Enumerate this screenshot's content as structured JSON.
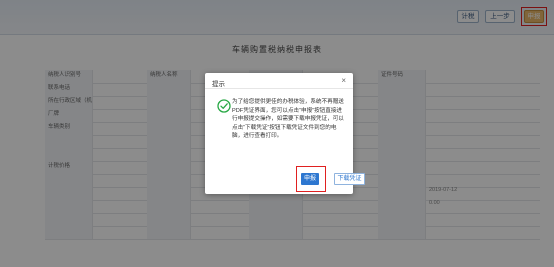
{
  "toolbar": {
    "calc_label": "计税",
    "prev_label": "上一步",
    "declare_label": "申报"
  },
  "page": {
    "title": "车辆购置税纳税申报表"
  },
  "form_rows": [
    {
      "label": "纳税人识别号",
      "value": "",
      "label2": "纳税人名称",
      "value2": "",
      "label3": "",
      "value3": "",
      "label4": "证件号码",
      "value4": ""
    },
    {
      "label": "联系电话",
      "value": "",
      "label2": "",
      "value2": "",
      "label3": "",
      "value3": "",
      "label4": "",
      "value4": ""
    },
    {
      "label": "所在行政区域（机动车登记地）",
      "value": "",
      "label2": "",
      "value2": "",
      "label3": "",
      "value3": "",
      "label4": "",
      "value4": ""
    },
    {
      "label": "厂牌",
      "value": "",
      "label2": "",
      "value2": "",
      "label3": "",
      "value3": "",
      "label4": "",
      "value4": ""
    },
    {
      "label": "车辆类别",
      "value": "",
      "label2": "",
      "value2": "",
      "label3": "",
      "value3": "",
      "label4": "",
      "value4": ""
    },
    {
      "label": "",
      "value": "",
      "label2": "",
      "value2": "",
      "label3": "",
      "value3": "",
      "label4": "",
      "value4": ""
    },
    {
      "label": "",
      "value": "",
      "label2": "",
      "value2": "",
      "label3": "",
      "value3": "",
      "label4": "",
      "value4": ""
    },
    {
      "label": "计税价格",
      "value": "",
      "label2": "",
      "value2": "",
      "label3": "",
      "value3": "",
      "label4": "",
      "value4": ""
    },
    {
      "label": "",
      "value": "",
      "label2": "",
      "value2": "",
      "label3": "",
      "value3": "",
      "label4": "",
      "value4": ""
    },
    {
      "label": "",
      "value": "",
      "label2": "",
      "value2": "",
      "label3": "",
      "value3": "2019-07-12",
      "label4": "",
      "value4": "2019-07-12"
    },
    {
      "label": "",
      "value": "",
      "label2": "",
      "value2": "",
      "label3": "",
      "value3": "",
      "label4": "",
      "value4": "0.00"
    },
    {
      "label": "",
      "value": "",
      "label2": "",
      "value2": "",
      "label3": "",
      "value3": "",
      "label4": "",
      "value4": ""
    },
    {
      "label": "",
      "value": "",
      "label2": "",
      "value2": "",
      "label3": "",
      "value3": "",
      "label4": "",
      "value4": ""
    }
  ],
  "dialog": {
    "title": "提示",
    "close_glyph": "×",
    "message": "为了给您提供更佳的办税体验，系统不再赠送PDF凭证界面，您可以点击“申报”按钮直接进行申报提交操作，如需要下载申报凭证，可以点击“下载凭证”按钮下载凭证文件到您的电脑，进行查看打印。",
    "ok_label": "申报",
    "download_label": "下载凭证"
  },
  "colors": {
    "accent": "#2d77d0",
    "highlight": "#e02020",
    "success": "#27a844"
  }
}
